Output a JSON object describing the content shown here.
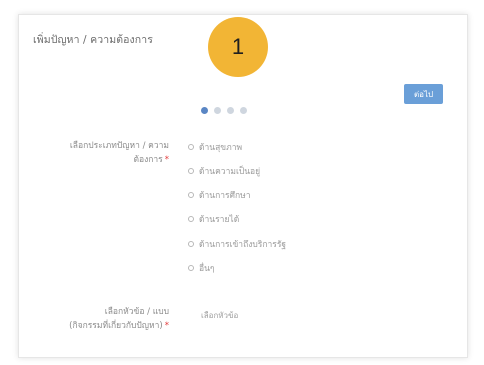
{
  "form": {
    "title": "เพิ่มปัญหา / ความต้องการ",
    "step_number": "1",
    "next_label": "ต่อไป",
    "steps_total": 4,
    "current_step": 1,
    "colors": {
      "accent": "#f2b535",
      "button": "#6a9fd8",
      "dot_active": "#5a86c4"
    }
  },
  "problem_type": {
    "label_line1": "เลือกประเภทปัญหา / ความ",
    "label_line2": "ต้องการ",
    "required_mark": "*",
    "options": [
      "ด้านสุขภาพ",
      "ด้านความเป็นอยู่",
      "ด้านการศึกษา",
      "ด้านรายได้",
      "ด้านการเข้าถึงบริการรัฐ",
      "อื่นๆ"
    ]
  },
  "target": {
    "label_line1": "เลือกหัวข้อ / แบบ",
    "label_line2": "(กิจกรรมที่เกี่ยวกับปัญหา)",
    "required_mark": "*",
    "placeholder": "เลือกหัวข้อ"
  }
}
